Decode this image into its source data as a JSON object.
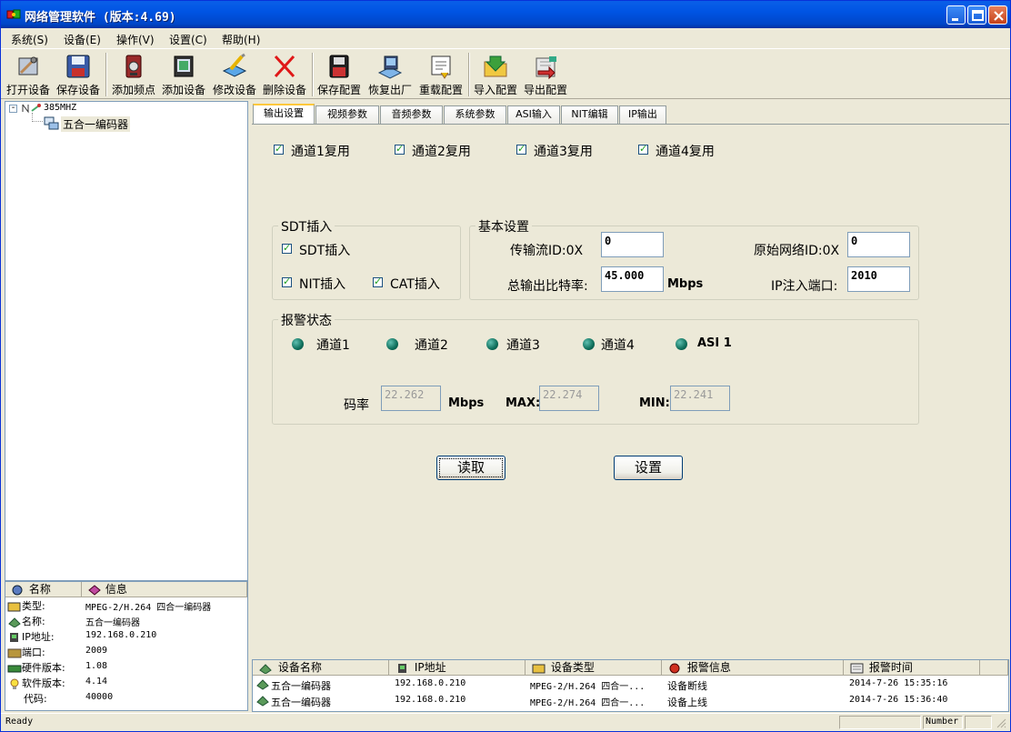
{
  "window": {
    "title": "网络管理软件 (版本:4.69)"
  },
  "menu": [
    "系统(S)",
    "设备(E)",
    "操作(V)",
    "设置(C)",
    "帮助(H)"
  ],
  "toolbar": [
    {
      "label": "打开设备",
      "icon": "open-device-icon"
    },
    {
      "label": "保存设备",
      "icon": "save-device-icon"
    },
    {
      "label": "添加频点",
      "icon": "add-frequency-icon"
    },
    {
      "label": "添加设备",
      "icon": "add-device-icon"
    },
    {
      "label": "修改设备",
      "icon": "edit-device-icon"
    },
    {
      "label": "删除设备",
      "icon": "delete-device-icon"
    },
    {
      "label": "保存配置",
      "icon": "save-config-icon"
    },
    {
      "label": "恢复出厂",
      "icon": "factory-reset-icon"
    },
    {
      "label": "重载配置",
      "icon": "reload-config-icon"
    },
    {
      "label": "导入配置",
      "icon": "import-config-icon"
    },
    {
      "label": "导出配置",
      "icon": "export-config-icon"
    }
  ],
  "tree": {
    "root": "385MHZ",
    "child": "五合一编码器",
    "expander": "-"
  },
  "props": {
    "headers": [
      "名称",
      "信息"
    ],
    "rows": [
      {
        "key": "类型:",
        "value": "MPEG-2/H.264 四合一编码器"
      },
      {
        "key": "名称:",
        "value": "五合一编码器"
      },
      {
        "key": "IP地址:",
        "value": "192.168.0.210"
      },
      {
        "key": "端口:",
        "value": "2009"
      },
      {
        "key": "硬件版本:",
        "value": "1.08"
      },
      {
        "key": "软件版本:",
        "value": "4.14"
      },
      {
        "key": "代码:",
        "value": "40000"
      }
    ]
  },
  "tabs": [
    "输出设置",
    "视频参数",
    "音频参数",
    "系统参数",
    "ASI输入",
    "NIT编辑",
    "IP输出"
  ],
  "channels": [
    "通道1复用",
    "通道2复用",
    "通道3复用",
    "通道4复用"
  ],
  "sdt": {
    "title": "SDT插入",
    "sdt": "SDT插入",
    "nit": "NIT插入",
    "cat": "CAT插入"
  },
  "basic": {
    "title": "基本设置",
    "ts_id_label": "传输流ID:0X",
    "ts_id_value": "0",
    "orig_net_label": "原始网络ID:0X",
    "orig_net_value": "0",
    "bitrate_label": "总输出比特率:",
    "bitrate_value": "45.000",
    "bitrate_unit": "Mbps",
    "ip_port_label": "IP注入端口:",
    "ip_port_value": "2010"
  },
  "alarm": {
    "title": "报警状态",
    "leds": [
      "通道1",
      "通道2",
      "通道3",
      "通道4",
      "ASI 1"
    ],
    "rate_label": "码率",
    "rate_value": "22.262",
    "rate_unit": "Mbps",
    "max_label": "MAX:",
    "max_value": "22.274",
    "min_label": "MIN:",
    "min_value": "22.241"
  },
  "buttons": {
    "read": "读取",
    "set": "设置"
  },
  "log": {
    "headers": [
      "设备名称",
      "IP地址",
      "设备类型",
      "报警信息",
      "报警时间"
    ],
    "rows": [
      {
        "name": "五合一编码器",
        "ip": "192.168.0.210",
        "type": "MPEG-2/H.264 四合一...",
        "alarm": "设备断线",
        "time": "2014-7-26 15:35:16"
      },
      {
        "name": "五合一编码器",
        "ip": "192.168.0.210",
        "type": "MPEG-2/H.264 四合一...",
        "alarm": "设备上线",
        "time": "2014-7-26 15:36:40"
      }
    ]
  },
  "status": {
    "left": "Ready",
    "right": "Number"
  }
}
